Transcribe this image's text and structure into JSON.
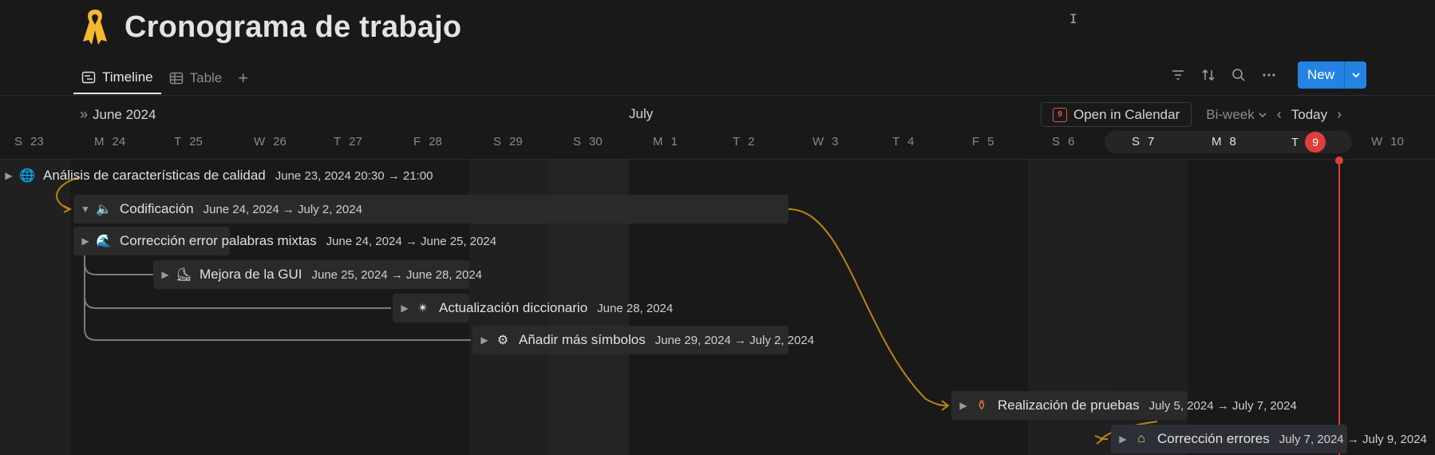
{
  "page": {
    "title": "Cronograma de trabajo",
    "icon": "ribbon-icon",
    "accent": "#f5b82e"
  },
  "views": {
    "tabs": [
      {
        "label": "Timeline",
        "icon": "timeline-icon",
        "active": true
      },
      {
        "label": "Table",
        "icon": "table-icon",
        "active": false
      }
    ],
    "add": "+"
  },
  "toolbar": {
    "new_label": "New",
    "new_color": "#2383e2"
  },
  "timeline": {
    "month_june": "June 2024",
    "month_july": "July",
    "open_calendar": "Open in Calendar",
    "calendar_icon_day": "9",
    "range": "Bi-week",
    "today": "Today",
    "today_color": "#e03e3e",
    "days": [
      {
        "wd": "S",
        "d": "23"
      },
      {
        "wd": "M",
        "d": "24"
      },
      {
        "wd": "T",
        "d": "25"
      },
      {
        "wd": "W",
        "d": "26"
      },
      {
        "wd": "T",
        "d": "27"
      },
      {
        "wd": "F",
        "d": "28"
      },
      {
        "wd": "S",
        "d": "29"
      },
      {
        "wd": "S",
        "d": "30"
      },
      {
        "wd": "M",
        "d": "1"
      },
      {
        "wd": "T",
        "d": "2"
      },
      {
        "wd": "W",
        "d": "3"
      },
      {
        "wd": "T",
        "d": "4"
      },
      {
        "wd": "F",
        "d": "5"
      },
      {
        "wd": "S",
        "d": "6"
      },
      {
        "wd": "S",
        "d": "7"
      },
      {
        "wd": "M",
        "d": "8"
      },
      {
        "wd": "T",
        "d": "9"
      },
      {
        "wd": "W",
        "d": "10"
      }
    ],
    "tasks": [
      {
        "name": "Análisis de características de calidad",
        "dates": "June 23, 2024 20:30 → 21:00",
        "icon": "globe-icon"
      },
      {
        "name": "Codificación",
        "dates": "June 24, 2024 → July 2, 2024",
        "icon": "speaker-icon"
      },
      {
        "name": "Corrección error palabras mixtas",
        "dates": "June 24, 2024 → June 25, 2024",
        "icon": "wave-icon"
      },
      {
        "name": "Mejora de la GUI",
        "dates": "June 25, 2024 → June 28, 2024",
        "icon": "skate-icon"
      },
      {
        "name": "Actualización diccionario",
        "dates": "June 28, 2024",
        "icon": "sparkle-icon"
      },
      {
        "name": "Añadir más símbolos",
        "dates": "June 29, 2024 → July 2, 2024",
        "icon": "gear-icon"
      },
      {
        "name": "Realización de pruebas",
        "dates": "July 5, 2024 → July 7, 2024",
        "icon": "vase-icon"
      },
      {
        "name": "Corrección errores",
        "dates": "July 7, 2024 → July 9, 2024",
        "icon": "house-icon"
      }
    ]
  }
}
